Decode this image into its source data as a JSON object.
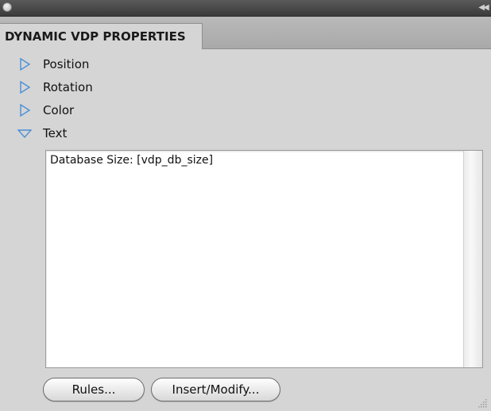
{
  "window": {
    "close_icon": "close-dot-icon",
    "collapse_icon": "double-chevron-icon",
    "collapse_glyph": "◀◀"
  },
  "tab": {
    "label": "DYNAMIC VDP PROPERTIES"
  },
  "sections": [
    {
      "label": "Position",
      "expanded": false
    },
    {
      "label": "Rotation",
      "expanded": false
    },
    {
      "label": "Color",
      "expanded": false
    },
    {
      "label": "Text",
      "expanded": true
    }
  ],
  "text_panel": {
    "content": "Database Size: [vdp_db_size]"
  },
  "buttons": {
    "rules_label": "Rules...",
    "insert_modify_label": "Insert/Modify..."
  },
  "colors": {
    "panel_bg": "#d5d5d5",
    "titlebar": "#4a4a4a",
    "triangle_stroke": "#4a8fd6"
  }
}
